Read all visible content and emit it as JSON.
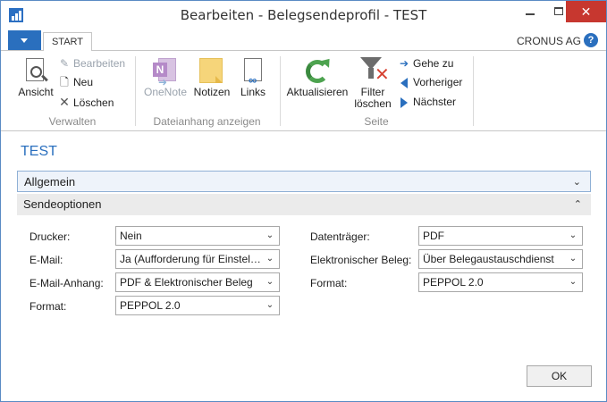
{
  "window": {
    "title": "Bearbeiten - Belegsendeprofil - TEST",
    "minimize": "—",
    "maximize": "☐",
    "close": "✕"
  },
  "ribbon_tabs": {
    "start_label": "START",
    "company": "CRONUS AG",
    "help": "?"
  },
  "ribbon": {
    "manage": {
      "group_label": "Verwalten",
      "view_label": "Ansicht",
      "edit_label": "Bearbeiten",
      "new_label": "Neu",
      "delete_label": "Löschen"
    },
    "attachments": {
      "group_label": "Dateianhang anzeigen",
      "onenote_label": "OneNote",
      "notes_label": "Notizen",
      "links_label": "Links"
    },
    "page": {
      "group_label": "Seite",
      "refresh_label": "Aktualisieren",
      "clear_filter_label_1": "Filter",
      "clear_filter_label_2": "löschen",
      "goto_label": "Gehe zu",
      "previous_label": "Vorheriger",
      "next_label": "Nächster"
    }
  },
  "content": {
    "page_title": "TEST",
    "fasttab_general": "Allgemein",
    "fasttab_send": "Sendeoptionen",
    "fields_left": {
      "printer_label": "Drucker:",
      "printer_value": "Nein",
      "email_label": "E-Mail:",
      "email_value": "Ja (Aufforderung für Einstellungen)",
      "email_attachment_label": "E-Mail-Anhang:",
      "email_attachment_value": "PDF & Elektronischer Beleg",
      "format_label": "Format:",
      "format_value": "PEPPOL 2.0"
    },
    "fields_right": {
      "disk_label": "Datenträger:",
      "disk_value": "PDF",
      "electronic_doc_label": "Elektronischer Beleg:",
      "electronic_doc_value": "Über Belegaustauschdienst",
      "format_label": "Format:",
      "format_value": "PEPPOL 2.0"
    },
    "ok_label": "OK"
  }
}
